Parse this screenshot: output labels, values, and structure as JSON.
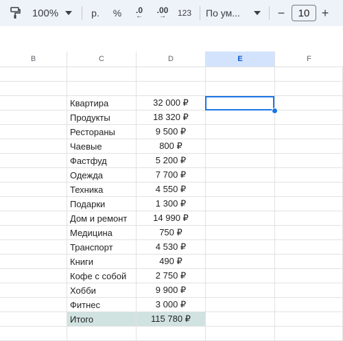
{
  "toolbar": {
    "zoom": "100%",
    "currency": "р.",
    "percent": "%",
    "decrease_decimals": ".0",
    "increase_decimals": ".00",
    "number_format": "123",
    "font": "По ум...",
    "minus": "−",
    "font_size": "10",
    "plus": "+"
  },
  "columns": [
    "B",
    "C",
    "D",
    "E",
    "F"
  ],
  "selected_column": "E",
  "rows": [
    {
      "name": "Квартира",
      "value": "32 000 ₽"
    },
    {
      "name": "Продукты",
      "value": "18 320 ₽"
    },
    {
      "name": "Рестораны",
      "value": "9 500 ₽"
    },
    {
      "name": "Чаевые",
      "value": "800 ₽"
    },
    {
      "name": "Фастфуд",
      "value": "5 200 ₽"
    },
    {
      "name": "Одежда",
      "value": "7 700 ₽"
    },
    {
      "name": "Техника",
      "value": "4 550 ₽"
    },
    {
      "name": "Подарки",
      "value": "1 300 ₽"
    },
    {
      "name": "Дом и ремонт",
      "value": "14 990 ₽"
    },
    {
      "name": "Медицина",
      "value": "750 ₽"
    },
    {
      "name": "Транспорт",
      "value": "4 530 ₽"
    },
    {
      "name": "Книги",
      "value": "490 ₽"
    },
    {
      "name": "Кофе с собой",
      "value": "2 750 ₽"
    },
    {
      "name": "Хобби",
      "value": "9 900 ₽"
    },
    {
      "name": "Фитнес",
      "value": "3 000 ₽"
    }
  ],
  "total": {
    "name": "Итого",
    "value": "115 780 ₽"
  },
  "colors": {
    "accent": "#1a73e8",
    "total_fill": "#d1e3e1",
    "toolbar_bg": "#eef2f9"
  }
}
